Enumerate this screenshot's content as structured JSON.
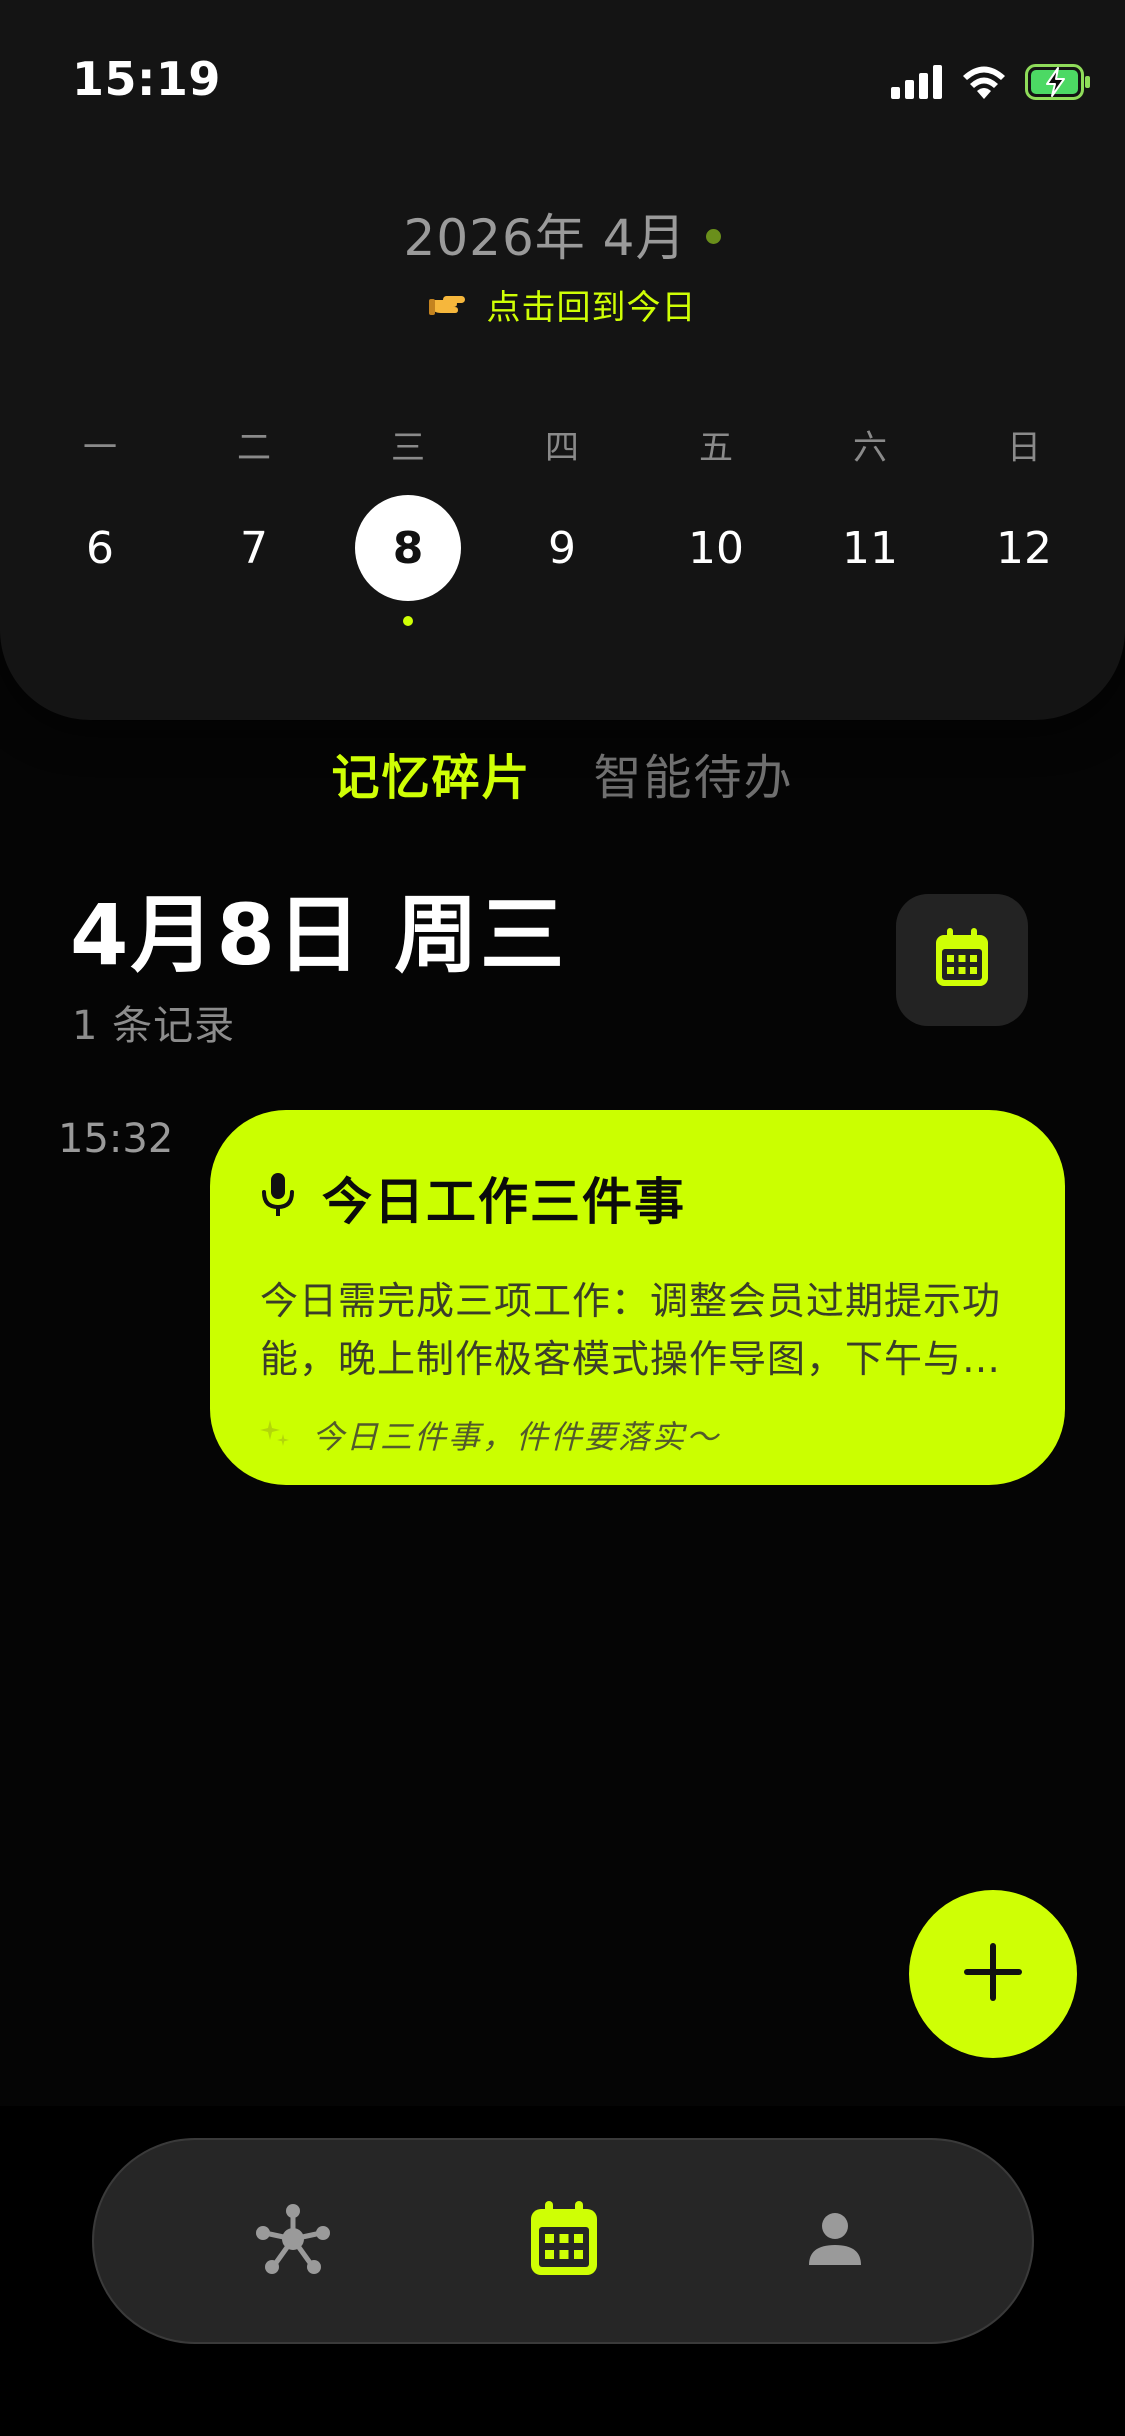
{
  "status_bar": {
    "time": "15:19"
  },
  "calendar": {
    "month_title": "2026年 4月",
    "back_to_today": "点击回到今日",
    "weekdays": [
      "一",
      "二",
      "三",
      "四",
      "五",
      "六",
      "日"
    ],
    "dates": [
      "6",
      "7",
      "8",
      "9",
      "10",
      "11",
      "12"
    ],
    "selected_date": "8"
  },
  "tabs": [
    {
      "label": "记忆碎片",
      "active": true
    },
    {
      "label": "智能待办",
      "active": false
    }
  ],
  "day": {
    "title": "4月8日 周三",
    "record_count": "1 条记录"
  },
  "entries": [
    {
      "time": "15:32",
      "title": "今日工作三件事",
      "body": "今日需完成三项工作：调整会员过期提示功能，晚上制作极客模式操作导图，下午与…",
      "tag": "今日三件事，件件要落实～"
    }
  ],
  "colors": {
    "accent": "#cfff05",
    "card": "#cbff00",
    "background": "#050505",
    "header": "#141414"
  },
  "nav": [
    {
      "icon": "network-icon",
      "active": false
    },
    {
      "icon": "calendar-icon",
      "active": true
    },
    {
      "icon": "profile-icon",
      "active": false
    }
  ]
}
